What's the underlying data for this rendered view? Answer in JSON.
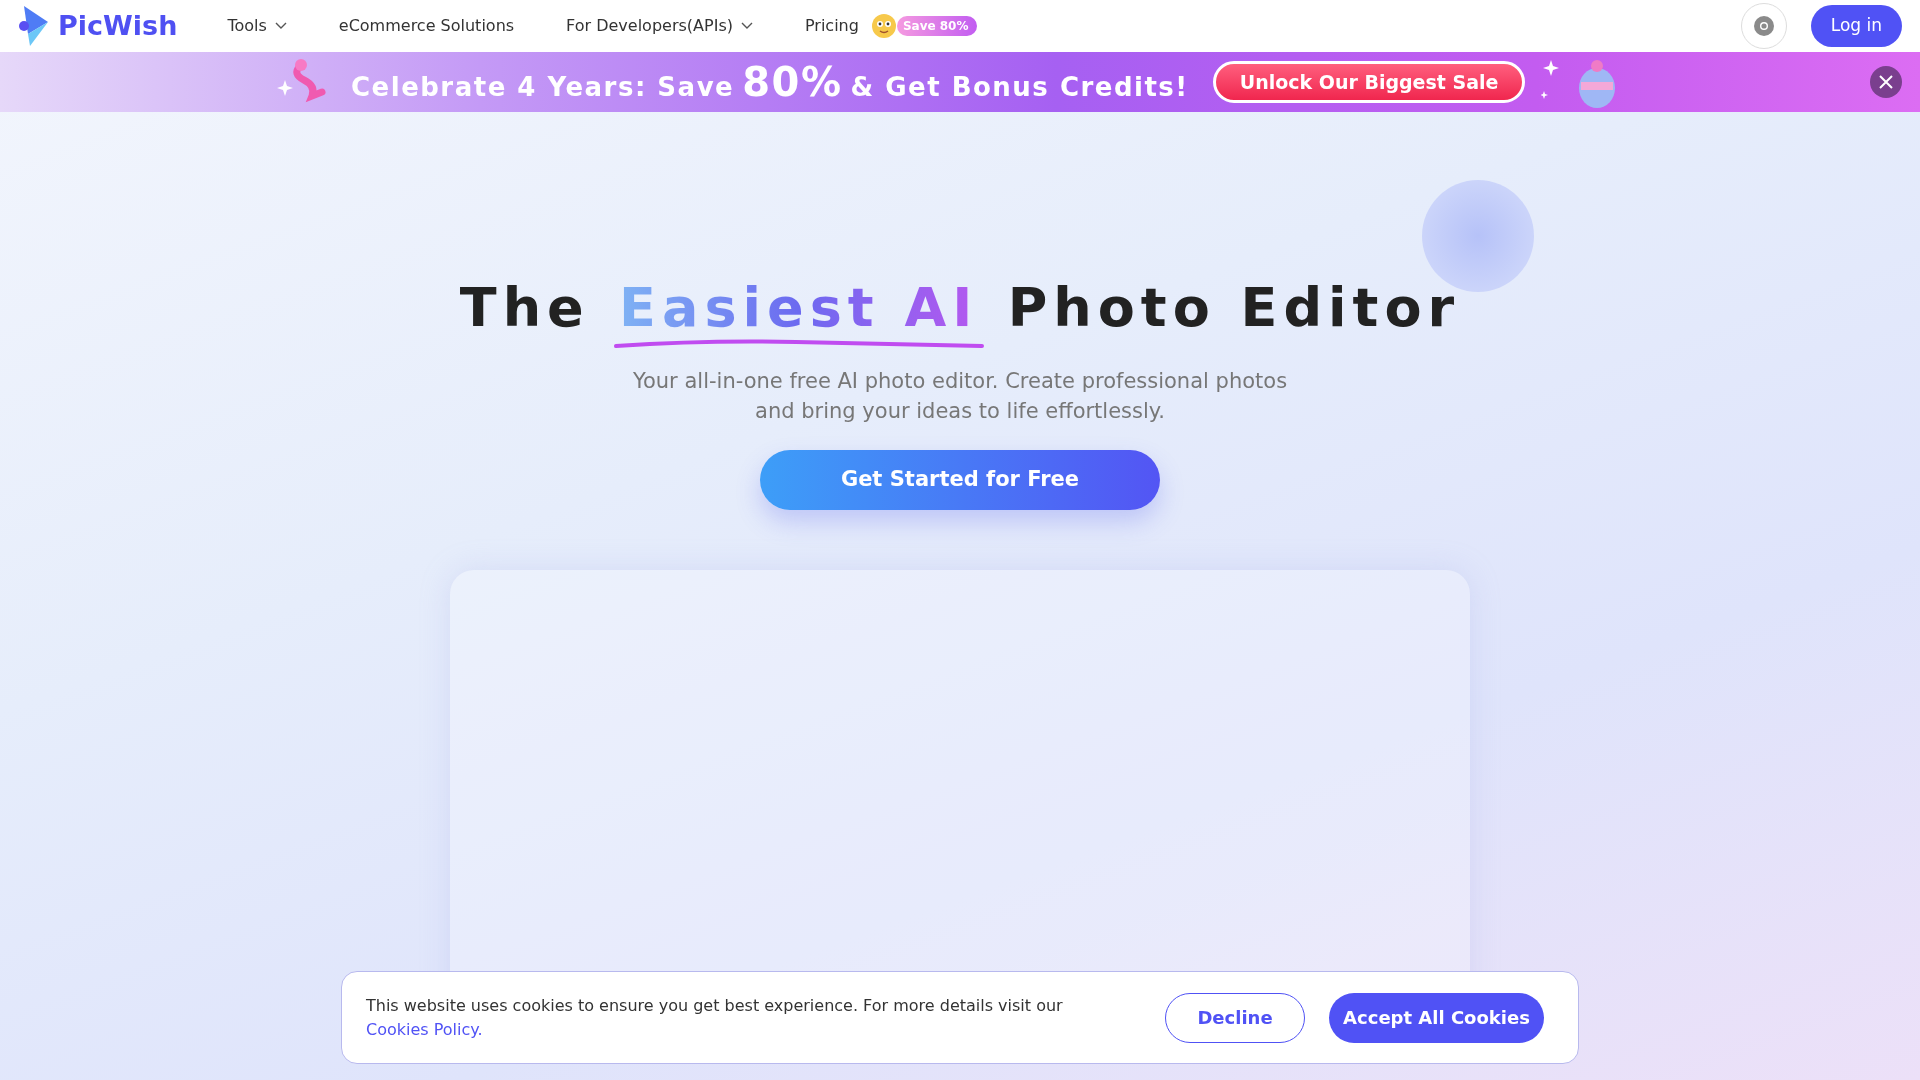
{
  "brand": {
    "name": "PicWish"
  },
  "nav": [
    {
      "label": "Tools",
      "has_menu": true
    },
    {
      "label": "eCommerce Solutions",
      "has_menu": false
    },
    {
      "label": "For Developers(APIs)",
      "has_menu": true
    },
    {
      "label": "Pricing",
      "has_menu": false
    }
  ],
  "pricing_badge": "Save 80%",
  "login": "Log in",
  "promo": {
    "before": "Celebrate 4 Years: Save",
    "highlight": "80%",
    "after": "& Get Bonus Credits!",
    "button": "Unlock Our Biggest Sale"
  },
  "hero": {
    "title_start": "The",
    "title_highlight": "Easiest AI",
    "title_end": "Photo Editor",
    "subtitle": "Your all-in-one free AI photo editor. Create professional photos and bring your ideas to life effortlessly.",
    "cta": "Get Started for Free"
  },
  "cookie": {
    "text": "This website uses cookies to ensure you get best experience. For more details visit our",
    "link": "Cookies Policy.",
    "decline": "Decline",
    "accept": "Accept All Cookies"
  }
}
